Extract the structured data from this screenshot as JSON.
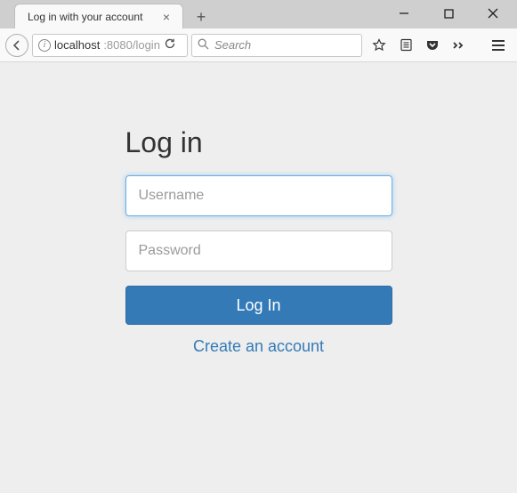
{
  "window": {
    "minimize": "–",
    "maximize": "□",
    "close": "×"
  },
  "tab": {
    "title": "Log in with your account",
    "close": "×",
    "newtab": "+"
  },
  "nav": {
    "url_host": "localhost",
    "url_port": ":8080/login",
    "search_placeholder": "Search"
  },
  "page": {
    "heading": "Log in",
    "username_placeholder": "Username",
    "username_value": "",
    "password_placeholder": "Password",
    "password_value": "",
    "login_button": "Log In",
    "create_link": "Create an account"
  }
}
